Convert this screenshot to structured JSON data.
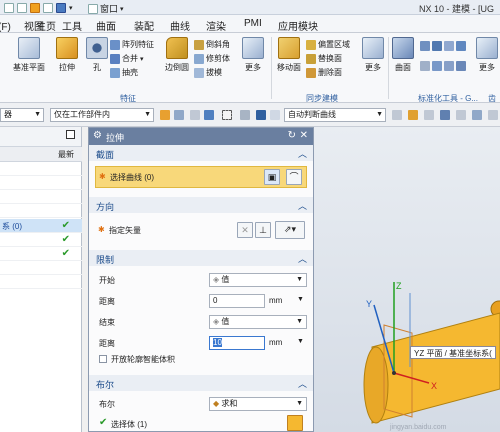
{
  "titlebar": {
    "window_label": "窗口",
    "title": "NX 10 - 建模 - [UG"
  },
  "menu": {
    "tabs": [
      "件(F)",
      "主页",
      "视图",
      "工具",
      "曲面",
      "装配",
      "曲线",
      "渲染",
      "PMI",
      "应用模块"
    ]
  },
  "ribbon": {
    "big_buttons": [
      "基准平面",
      "拉伸",
      "孔",
      "边倒圆",
      "更多",
      "移动面",
      "更多",
      "曲面",
      "更多"
    ],
    "small_buttons": [
      "阵列特征",
      "合并",
      "抽壳",
      "倒斜角",
      "修剪体",
      "拔模",
      "偏置区域",
      "替换面",
      "删除面"
    ],
    "groups": [
      "特征",
      "同步建模",
      "标准化工具 - G...",
      "齿"
    ]
  },
  "toolbar": {
    "filter_combo": "器",
    "scope_combo": "仅在工作部件内",
    "curve_rule_combo": "自动判断曲线"
  },
  "navigator": {
    "column_latest": "最新",
    "selected_row_label": "系 (0)",
    "rows_checked": [
      true,
      true,
      true
    ]
  },
  "dialog": {
    "title": "拉伸",
    "section_label": "截面",
    "select_curve": "选择曲线 (0)",
    "direction_label": "方向",
    "specify_vector": "指定矢量",
    "limits_label": "限制",
    "start_label": "开始",
    "start_value": "值",
    "distance1_label": "距离",
    "distance1_value": "0",
    "distance1_unit": "mm",
    "end_label": "结束",
    "end_value": "值",
    "distance2_label": "距离",
    "distance2_value": "10",
    "distance2_unit": "mm",
    "open_profile_label": "开放轮廓智能体积",
    "boolean_section": "布尔",
    "boolean_label": "布尔",
    "boolean_value": "求和",
    "select_body": "选择体 (1)"
  },
  "graphics": {
    "tooltip": "YZ 平面 / 基准坐标系(",
    "axis_labels": [
      "Z",
      "Y",
      "X"
    ],
    "watermark": "jingyan.baidu.com"
  },
  "colors": {
    "highlight": "#f8d87a",
    "accent": "#6a7fa0",
    "solid": "#f5b830",
    "axis_x": "#d02020",
    "axis_y": "#2060c0",
    "axis_z": "#20a020"
  }
}
